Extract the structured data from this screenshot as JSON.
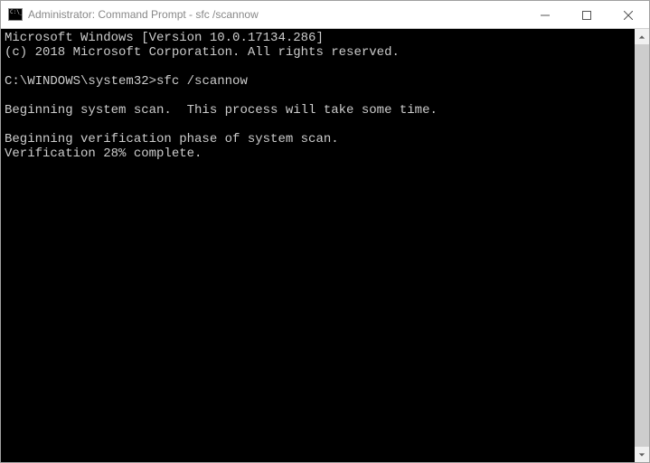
{
  "window": {
    "title": "Administrator: Command Prompt - sfc  /scannow"
  },
  "terminal": {
    "line_os": "Microsoft Windows [Version 10.0.17134.286]",
    "line_copyright": "(c) 2018 Microsoft Corporation. All rights reserved.",
    "prompt": "C:\\WINDOWS\\system32>",
    "command": "sfc /scannow",
    "line_begin_scan": "Beginning system scan.  This process will take some time.",
    "line_begin_verify": "Beginning verification phase of system scan.",
    "line_verify_pct": "Verification 28% complete."
  }
}
